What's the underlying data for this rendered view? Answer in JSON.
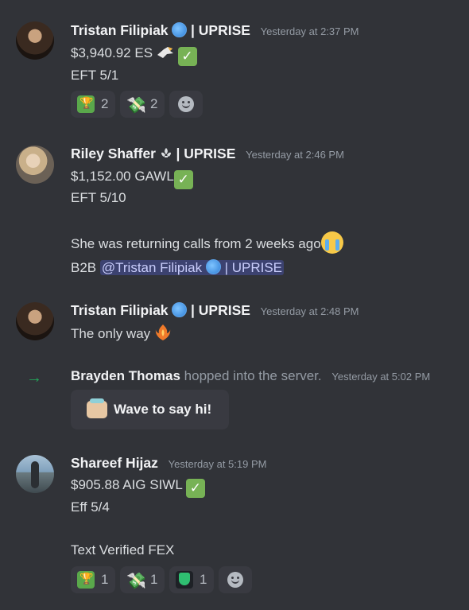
{
  "messages": [
    {
      "author": "Tristan Filipiak",
      "author_suffix": "| UPRISE",
      "timestamp": "Yesterday at 2:37 PM",
      "line1": "$3,940.92 ES",
      "line2": "EFT 5/1",
      "reactions": [
        {
          "emoji": "trophy-icon",
          "count": "2"
        },
        {
          "emoji": "money-wings-icon",
          "count": "2"
        }
      ]
    },
    {
      "author": "Riley Shaffer",
      "author_suffix": "| UPRISE",
      "timestamp": "Yesterday at 2:46 PM",
      "line1": "$1,152.00 GAWL",
      "line2": "EFT 5/10",
      "line3": "She was returning calls from 2 weeks ago",
      "line4_prefix": "B2B",
      "mention": "@Tristan Filipiak",
      "mention_suffix": "| UPRISE"
    },
    {
      "author": "Tristan Filipiak",
      "author_suffix": "| UPRISE",
      "timestamp": "Yesterday at 2:48 PM",
      "line1": "The only way"
    },
    {
      "author": "Shareef Hijaz",
      "timestamp": "Yesterday at 5:19 PM",
      "line1": "$905.88 AIG SIWL",
      "line2": "Eff 5/4",
      "line3": "Text Verified FEX",
      "reactions": [
        {
          "emoji": "trophy-icon",
          "count": "1"
        },
        {
          "emoji": "money-wings-icon",
          "count": "1"
        },
        {
          "emoji": "shield-icon",
          "count": "1"
        }
      ]
    }
  ],
  "system": {
    "arrow": "→",
    "name": "Brayden Thomas",
    "text": "hopped into the server.",
    "timestamp": "Yesterday at 5:02 PM",
    "wave_button": "Wave to say hi!"
  },
  "colors": {
    "background": "#313338",
    "mention_bg": "#3c4270",
    "join_arrow": "#23a55a",
    "check": "#77b255"
  }
}
